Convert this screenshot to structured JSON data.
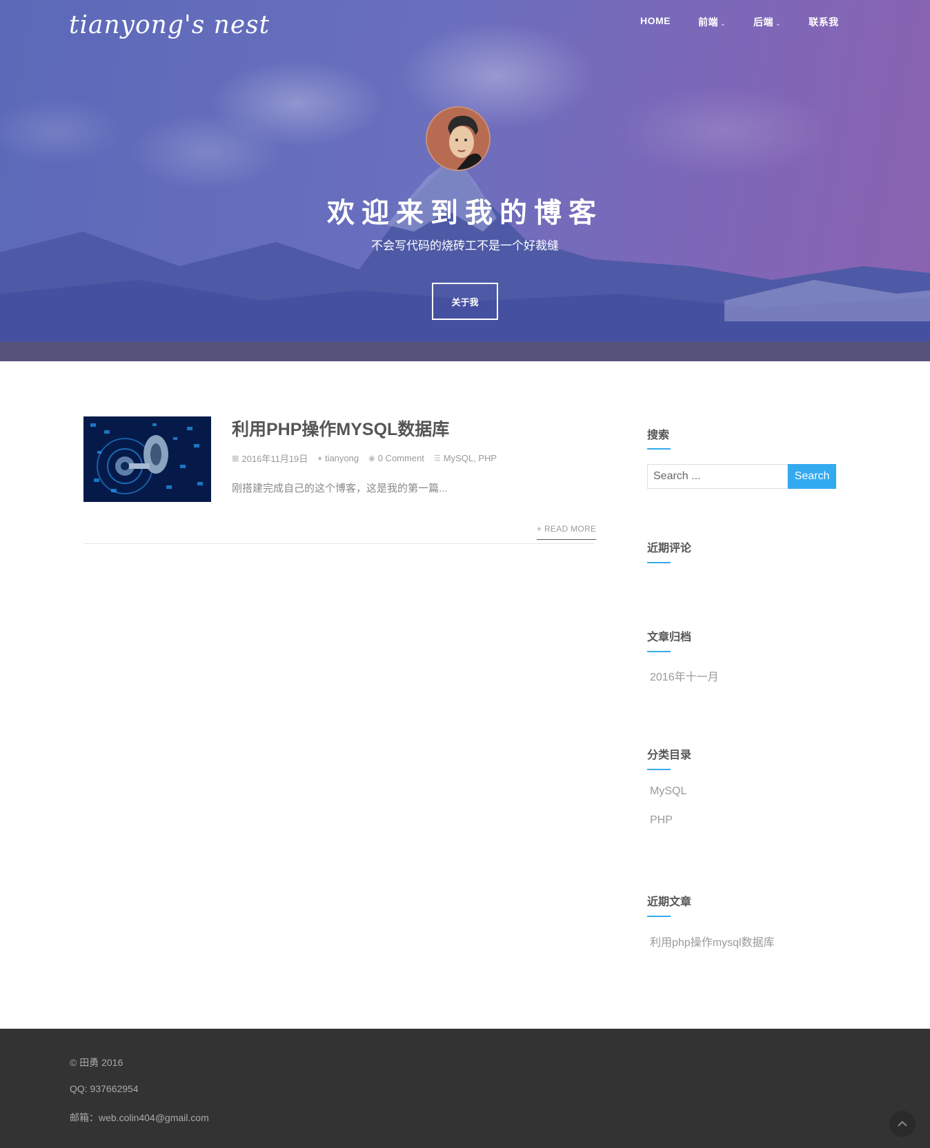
{
  "header": {
    "logo": "tianyong's nest",
    "nav": [
      {
        "label": "HOME"
      },
      {
        "label": "前端",
        "dropdown": true
      },
      {
        "label": "后端",
        "dropdown": true
      },
      {
        "label": "联系我"
      }
    ],
    "chevron": "⌄"
  },
  "hero": {
    "title": "欢迎来到我的博客",
    "subtitle": "不会写代码的烧砖工不是一个好裁缝",
    "button_label": "关于我"
  },
  "post": {
    "title": "利用PHP操作MYSQL数据库",
    "date": "2016年11月19日",
    "author": "tianyong",
    "comments": "0 Comment",
    "categories": "MySQL, PHP",
    "excerpt": "刚搭建完成自己的这个博客，这是我的第一篇...",
    "read_more": "+ READ MORE"
  },
  "sidebar": {
    "search": {
      "title": "搜索",
      "placeholder": "Search ...",
      "button": "Search"
    },
    "recent_comments": {
      "title": "近期评论"
    },
    "archives": {
      "title": "文章归档",
      "items": [
        "2016年十一月"
      ]
    },
    "categories": {
      "title": "分类目录",
      "items": [
        "MySQL",
        "PHP"
      ]
    },
    "recent_posts": {
      "title": "近期文章",
      "items": [
        "利用php操作mysql数据库"
      ]
    }
  },
  "footer": {
    "copyright": "© 田勇 2016",
    "qq": "QQ: 937662954",
    "email": "邮箱：web.colin404@gmail.com"
  },
  "colors": {
    "accent": "#33aaf0",
    "footer_bg": "#333333",
    "hero_overlay": "#6a6fbe"
  }
}
